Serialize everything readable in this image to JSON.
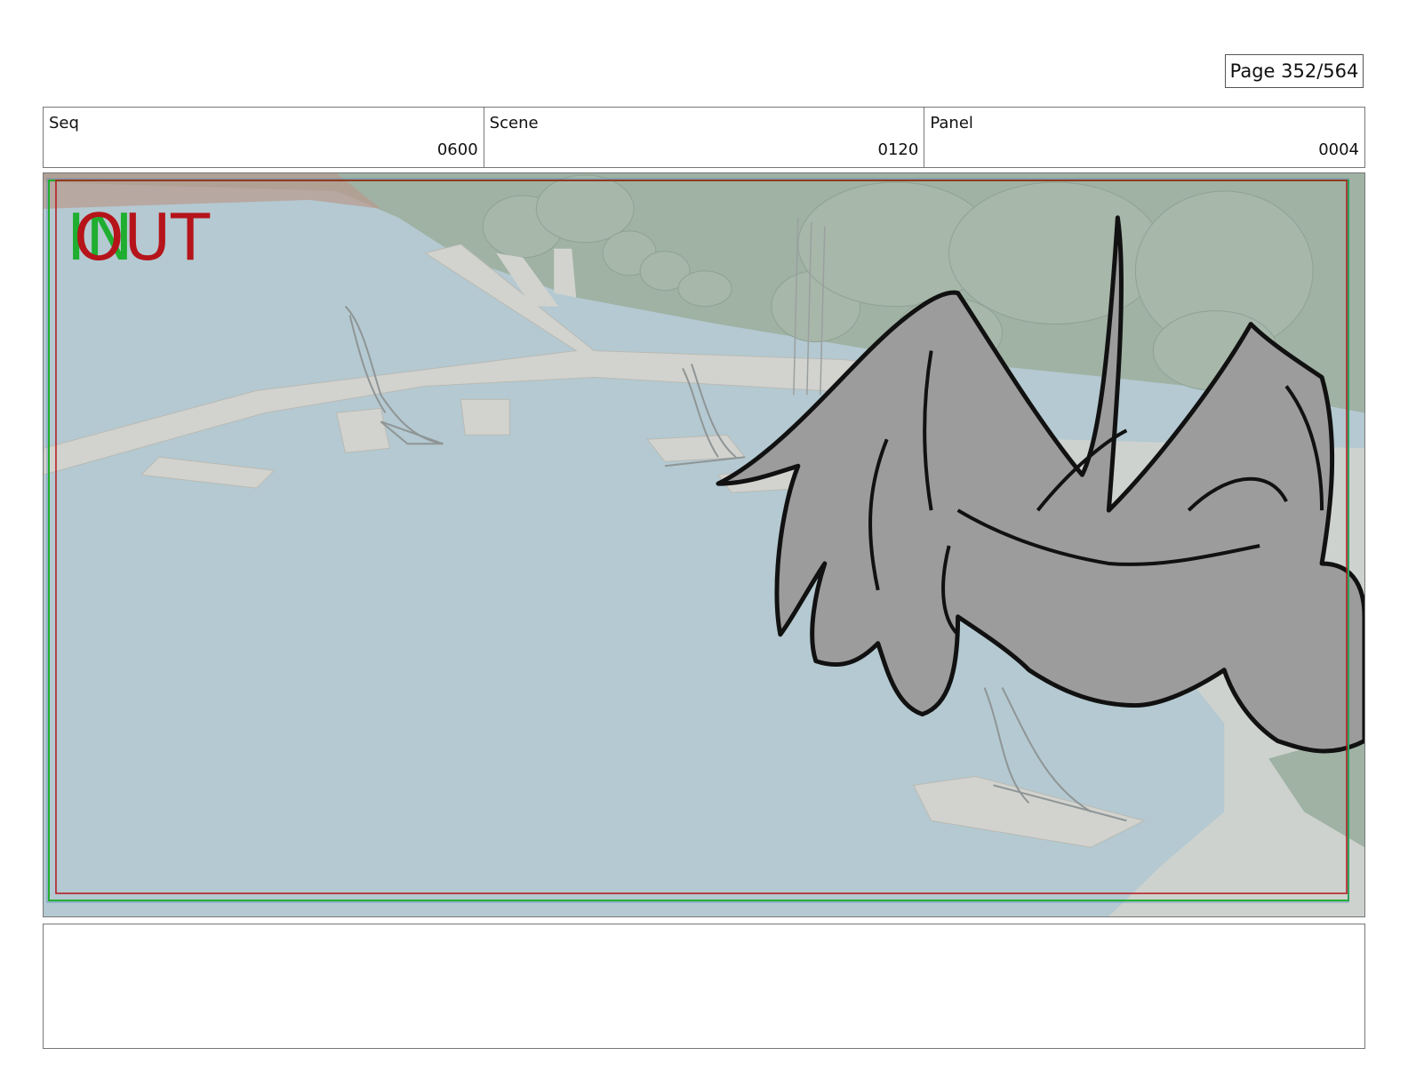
{
  "page": {
    "label": "Page 352/564"
  },
  "header": {
    "seq": {
      "label": "Seq",
      "value": "0600"
    },
    "scene": {
      "label": "Scene",
      "value": "0120"
    },
    "panel": {
      "label": "Panel",
      "value": "0004"
    }
  },
  "frame": {
    "overlay": {
      "in_text": "IN",
      "out_text": "OUT"
    },
    "colors": {
      "in": "#1fae2f",
      "out": "#b5141a",
      "water": "#b4c9d1",
      "foliage": "#9fb2a4"
    }
  },
  "notes": {
    "text": ""
  }
}
